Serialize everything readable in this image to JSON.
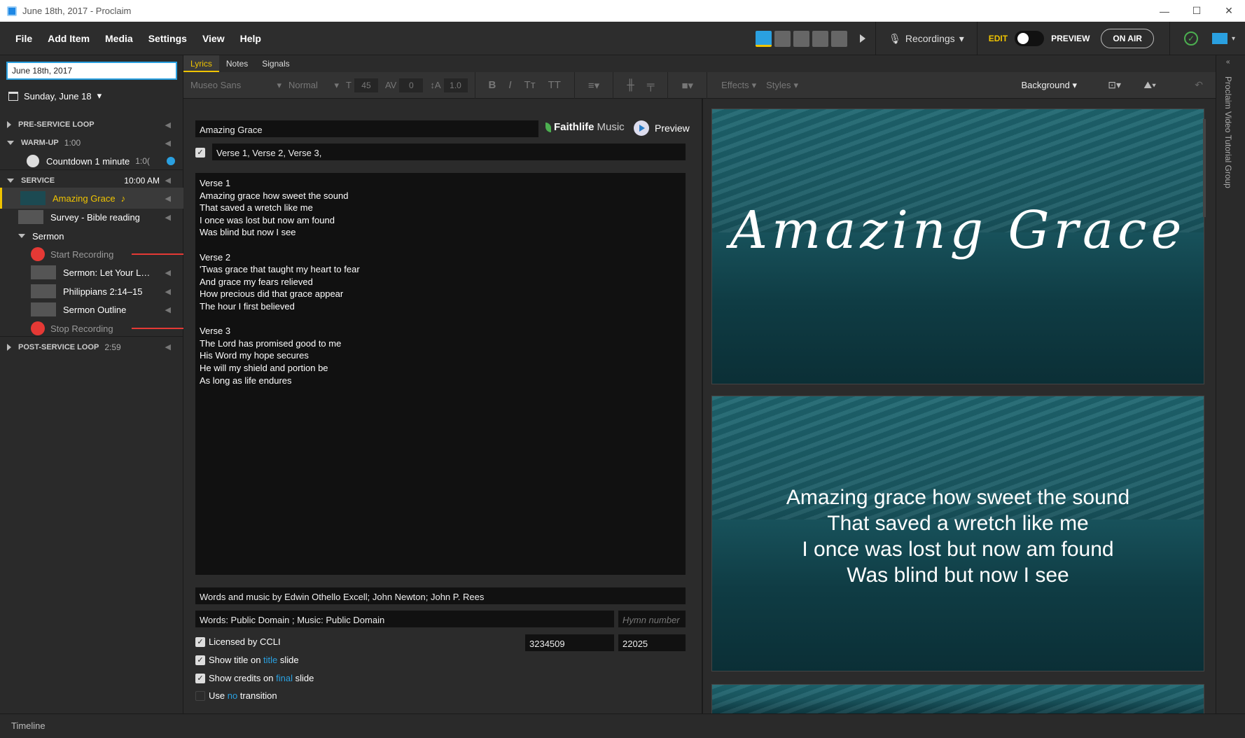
{
  "window": {
    "title": "June 18th, 2017 - Proclaim"
  },
  "menu": [
    "File",
    "Add Item",
    "Media",
    "Settings",
    "View",
    "Help"
  ],
  "topbar": {
    "recordings": "Recordings",
    "edit": "EDIT",
    "preview": "PREVIEW",
    "on_air": "ON AIR"
  },
  "sidebar": {
    "date_input": "June 18th, 2017",
    "day": "Sunday, June 18",
    "pre_service": "PRE-SERVICE LOOP",
    "warmup": "WARM-UP",
    "warmup_time": "1:00",
    "countdown": "Countdown 1 minute",
    "countdown_time": "1:0(",
    "service": "SERVICE",
    "service_time": "10:00 AM",
    "item_amazing": "Amazing Grace",
    "item_survey": "Survey - Bible reading",
    "sermon": "Sermon",
    "start_rec": "Start Recording",
    "sermon_item": "Sermon: Let Your L…",
    "phil": "Philippians 2:14–15",
    "outline": "Sermon Outline",
    "stop_rec": "Stop Recording",
    "post": "POST-SERVICE LOOP",
    "post_time": "2:59"
  },
  "tabs": [
    "Lyrics",
    "Notes",
    "Signals"
  ],
  "toolbar": {
    "font": "Museo Sans",
    "weight": "Normal",
    "size": "45",
    "spacing": "0",
    "line": "1.0",
    "effects": "Effects",
    "styles": "Styles",
    "background": "Background"
  },
  "editor": {
    "title": "Amazing Grace",
    "faithlife": "Faithlife",
    "music": "Music",
    "preview": "Preview",
    "order": "Verse 1, Verse 2, Verse 3,",
    "lyrics": "Verse 1\nAmazing grace how sweet the sound\nThat saved a wretch like me\nI once was lost but now am found\nWas blind but now I see\n\nVerse 2\n'Twas grace that taught my heart to fear\nAnd grace my fears relieved\nHow precious did that grace appear\nThe hour I first believed\n\nVerse 3\nThe Lord has promised good to me\nHis Word my hope secures\nHe will my shield and portion be\nAs long as life endures",
    "credits": "Words and music by Edwin Othello Excell; John Newton; John P. Rees",
    "copyright": "Words: Public Domain ; Music: Public Domain",
    "hymn_placeholder": "Hymn number",
    "ccli_label": "Licensed by CCLI",
    "ccli1": "3234509",
    "ccli2": "22025",
    "opt_title_a": "Show title on ",
    "opt_title_b": "title",
    "opt_title_c": " slide",
    "opt_credits_a": "Show credits on ",
    "opt_credits_b": "final",
    "opt_credits_c": " slide",
    "opt_trans_a": "Use ",
    "opt_trans_b": "no",
    "opt_trans_c": " transition"
  },
  "slides": {
    "title": "Amazing Grace",
    "l1": "Amazing grace how sweet the sound",
    "l2": "That saved a wretch like me",
    "l3": "I once was lost but now am found",
    "l4": "Was blind but now I see"
  },
  "rail": "Proclaim Video Tutorial Group",
  "timeline": "Timeline"
}
